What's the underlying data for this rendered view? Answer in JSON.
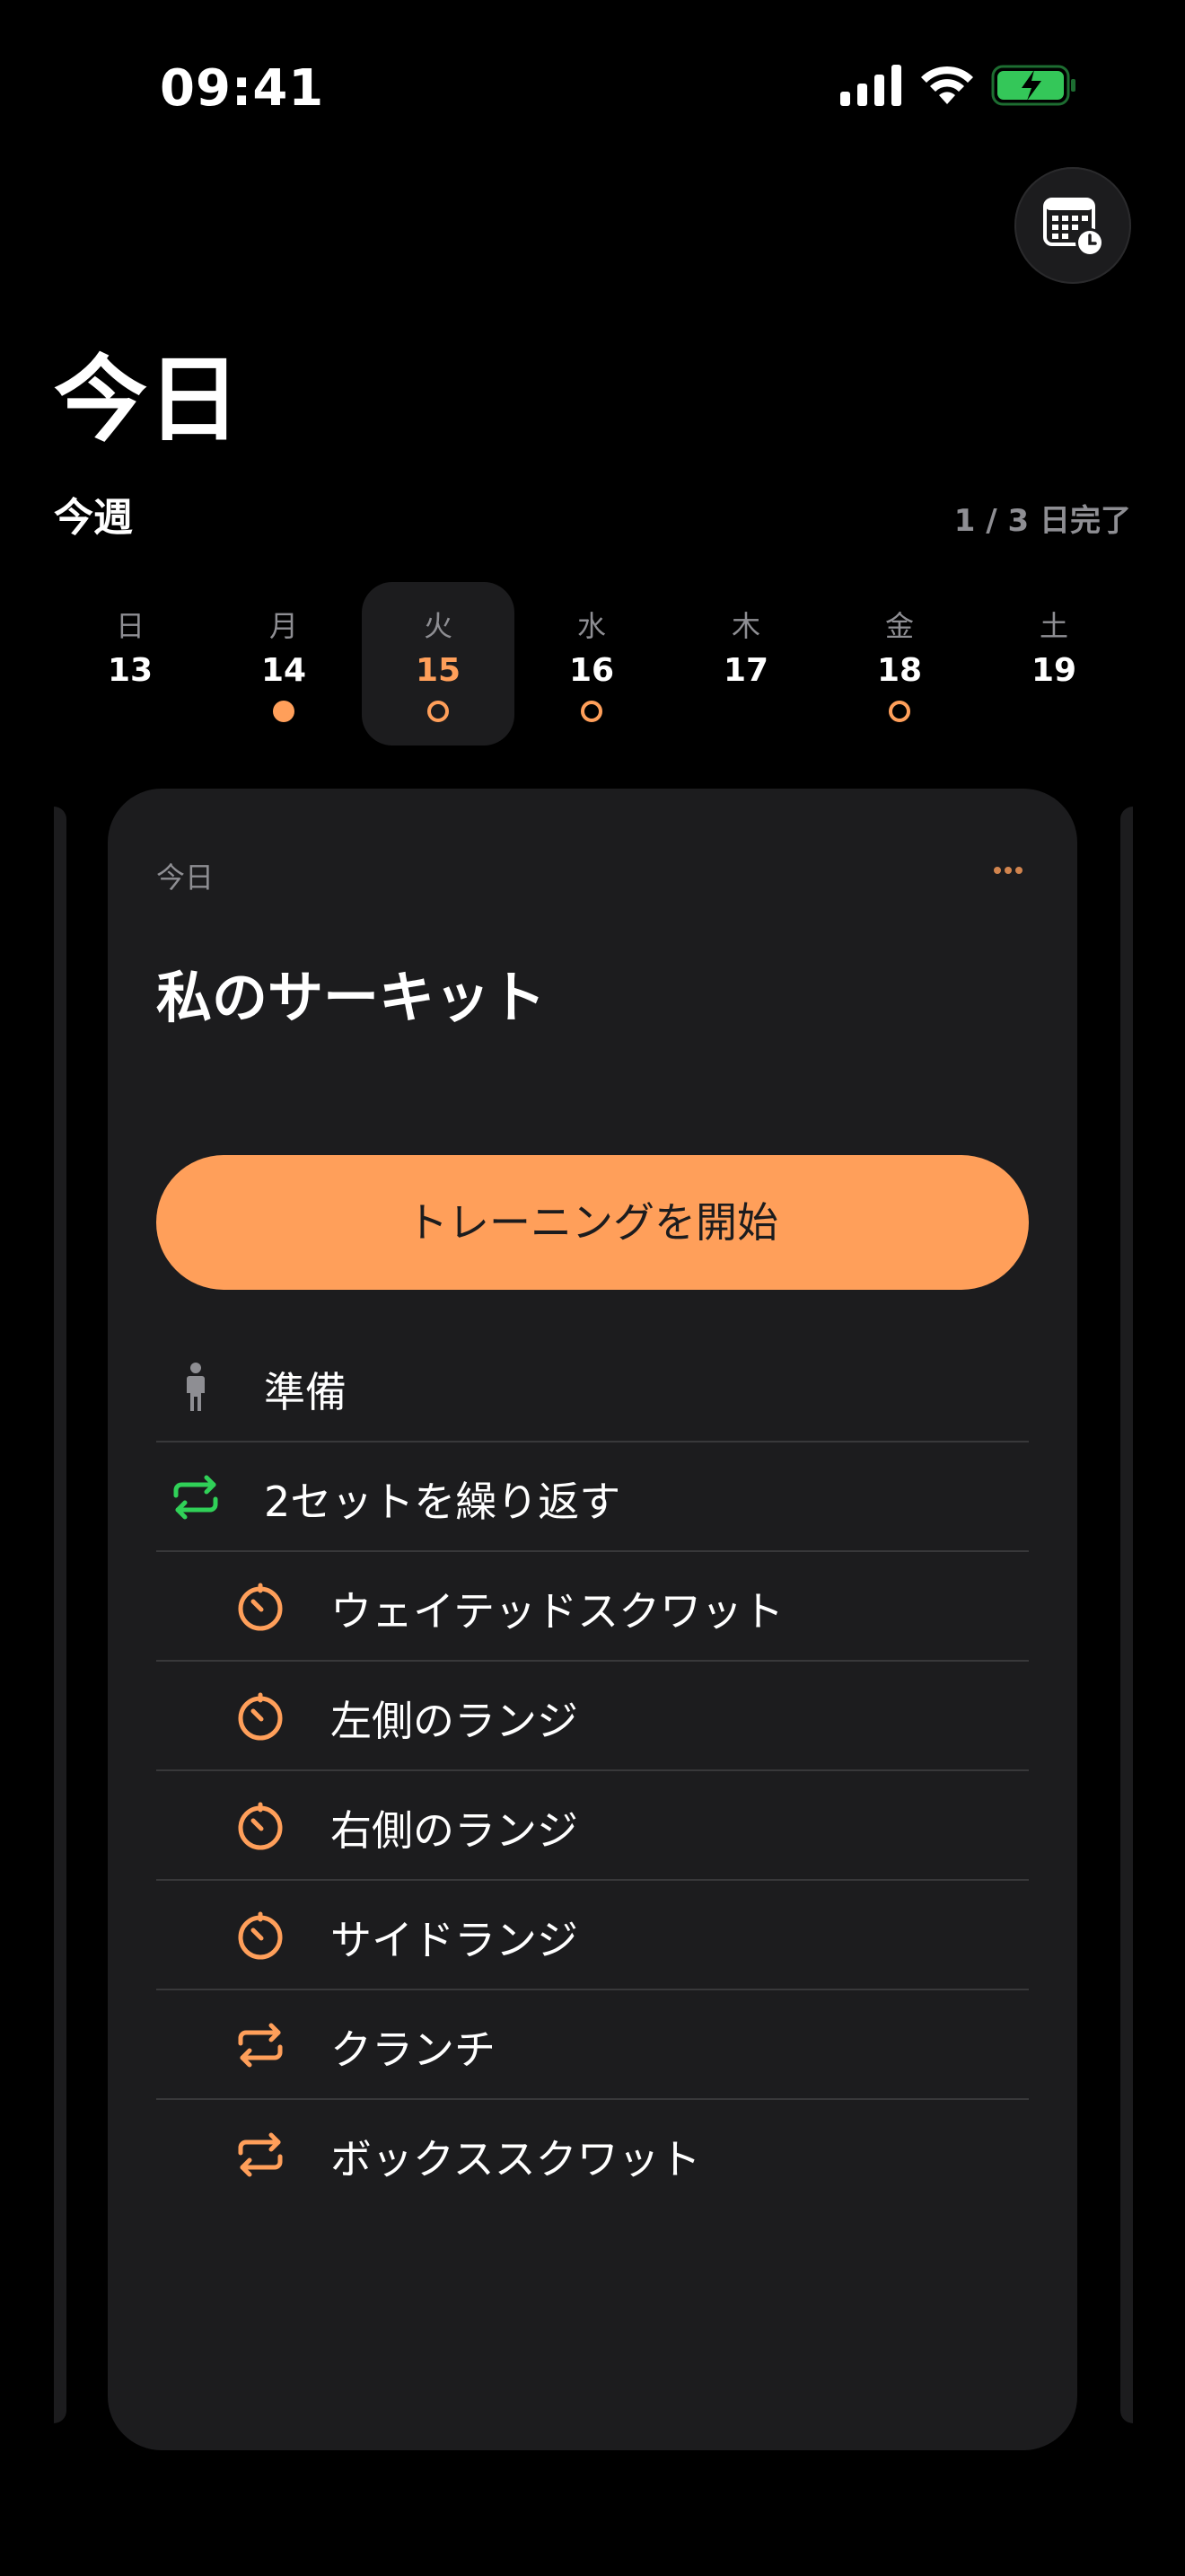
{
  "status": {
    "time": "09:41"
  },
  "header": {
    "title": "今日"
  },
  "week": {
    "label": "今週",
    "progress": "1 / 3 日完了",
    "days": [
      {
        "name": "日",
        "date": "13",
        "marker": "none"
      },
      {
        "name": "月",
        "date": "14",
        "marker": "filled"
      },
      {
        "name": "火",
        "date": "15",
        "marker": "outline",
        "selected": true
      },
      {
        "name": "水",
        "date": "16",
        "marker": "outline"
      },
      {
        "name": "木",
        "date": "17",
        "marker": "none"
      },
      {
        "name": "金",
        "date": "18",
        "marker": "outline"
      },
      {
        "name": "土",
        "date": "19",
        "marker": "none"
      }
    ]
  },
  "card": {
    "tag": "今日",
    "title": "私のサーキット",
    "start_label": "トレーニングを開始",
    "rows": [
      {
        "label": "準備",
        "icon": "person-standing-icon"
      },
      {
        "label": "2セットを繰り返す",
        "icon": "repeat-icon"
      },
      {
        "label": "ウェイテッドスクワット",
        "icon": "timer-icon"
      },
      {
        "label": "左側のランジ",
        "icon": "timer-icon"
      },
      {
        "label": "右側のランジ",
        "icon": "timer-icon"
      },
      {
        "label": "サイドランジ",
        "icon": "timer-icon"
      },
      {
        "label": "クランチ",
        "icon": "repeat-icon"
      },
      {
        "label": "ボックススクワット",
        "icon": "repeat-icon"
      }
    ]
  },
  "colors": {
    "accent": "#ff9f5a",
    "repeat_green": "#30d158",
    "card_bg": "#1c1c1e",
    "secondary_text": "#8e8e93"
  }
}
